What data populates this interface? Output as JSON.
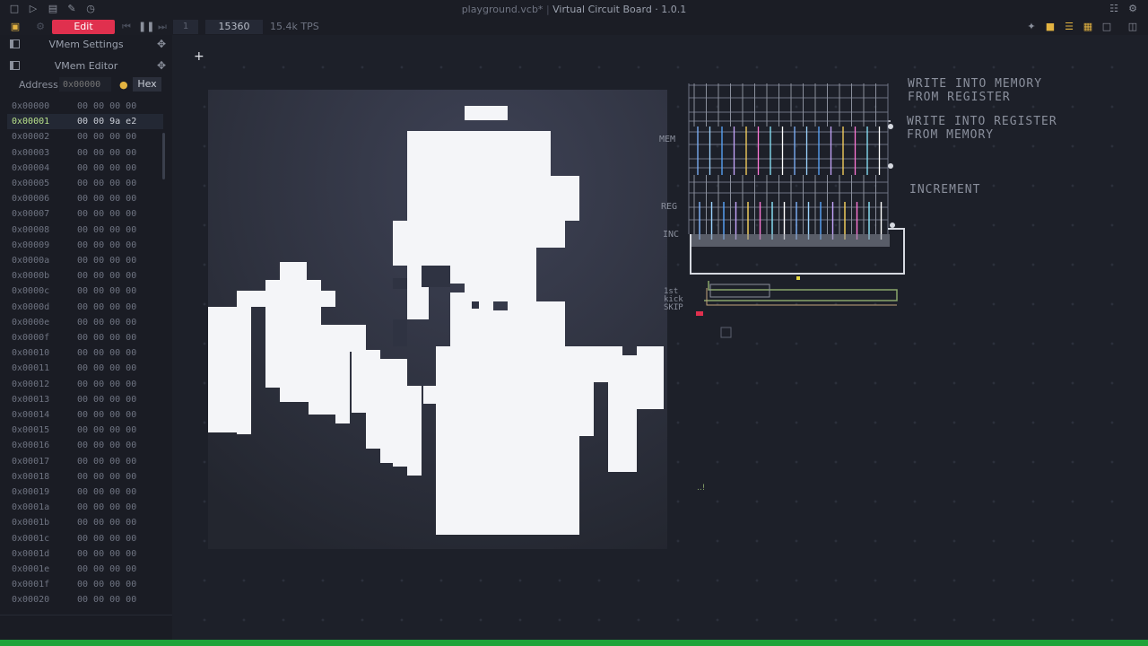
{
  "window": {
    "title": "playground.vcb*",
    "app_name": "Virtual Circuit Board · 1.0.1"
  },
  "toolbar": {
    "mode_label": "Edit",
    "step_value": "1",
    "tick_value": "15360",
    "tps_label": "15.4k TPS"
  },
  "sidebar": {
    "vmem_settings_title": "VMem Settings",
    "vmem_editor_title": "VMem Editor",
    "address_label": "Address",
    "address_placeholder": "0x00000",
    "hex_label": "Hex",
    "rows": [
      {
        "addr": "0x00000",
        "val": "00 00 00 00"
      },
      {
        "addr": "0x00001",
        "val": "00 00 9a e2"
      },
      {
        "addr": "0x00002",
        "val": "00 00 00 00"
      },
      {
        "addr": "0x00003",
        "val": "00 00 00 00"
      },
      {
        "addr": "0x00004",
        "val": "00 00 00 00"
      },
      {
        "addr": "0x00005",
        "val": "00 00 00 00"
      },
      {
        "addr": "0x00006",
        "val": "00 00 00 00"
      },
      {
        "addr": "0x00007",
        "val": "00 00 00 00"
      },
      {
        "addr": "0x00008",
        "val": "00 00 00 00"
      },
      {
        "addr": "0x00009",
        "val": "00 00 00 00"
      },
      {
        "addr": "0x0000a",
        "val": "00 00 00 00"
      },
      {
        "addr": "0x0000b",
        "val": "00 00 00 00"
      },
      {
        "addr": "0x0000c",
        "val": "00 00 00 00"
      },
      {
        "addr": "0x0000d",
        "val": "00 00 00 00"
      },
      {
        "addr": "0x0000e",
        "val": "00 00 00 00"
      },
      {
        "addr": "0x0000f",
        "val": "00 00 00 00"
      },
      {
        "addr": "0x00010",
        "val": "00 00 00 00"
      },
      {
        "addr": "0x00011",
        "val": "00 00 00 00"
      },
      {
        "addr": "0x00012",
        "val": "00 00 00 00"
      },
      {
        "addr": "0x00013",
        "val": "00 00 00 00"
      },
      {
        "addr": "0x00014",
        "val": "00 00 00 00"
      },
      {
        "addr": "0x00015",
        "val": "00 00 00 00"
      },
      {
        "addr": "0x00016",
        "val": "00 00 00 00"
      },
      {
        "addr": "0x00017",
        "val": "00 00 00 00"
      },
      {
        "addr": "0x00018",
        "val": "00 00 00 00"
      },
      {
        "addr": "0x00019",
        "val": "00 00 00 00"
      },
      {
        "addr": "0x0001a",
        "val": "00 00 00 00"
      },
      {
        "addr": "0x0001b",
        "val": "00 00 00 00"
      },
      {
        "addr": "0x0001c",
        "val": "00 00 00 00"
      },
      {
        "addr": "0x0001d",
        "val": "00 00 00 00"
      },
      {
        "addr": "0x0001e",
        "val": "00 00 00 00"
      },
      {
        "addr": "0x0001f",
        "val": "00 00 00 00"
      },
      {
        "addr": "0x00020",
        "val": "00 00 00 00"
      }
    ],
    "selected_index": 1
  },
  "circuit": {
    "label_mem": "MEM",
    "label_reg": "REG",
    "label_inc": "INC",
    "label_kick": "1st\nkick\nSKIP",
    "write_mem_line1": "WRITE INTO MEMORY",
    "write_mem_line2": "FROM REGISTER",
    "write_reg_line1": "WRITE INTO REGISTER",
    "write_reg_line2": "FROM MEMORY",
    "increment": "INCREMENT"
  },
  "colors": {
    "edit_button": "#e0304e",
    "selected_address": "#b7e08a",
    "status_bar": "#1fa33a",
    "display_pixel": "#f4f5f8"
  },
  "icons": [
    "new-file-icon",
    "open-folder-icon",
    "save-icon",
    "save-as-icon",
    "history-icon",
    "book-icon",
    "settings-gear-icon",
    "dock-panel-icon",
    "play-step-icon",
    "pause-icon",
    "layers-icon"
  ]
}
